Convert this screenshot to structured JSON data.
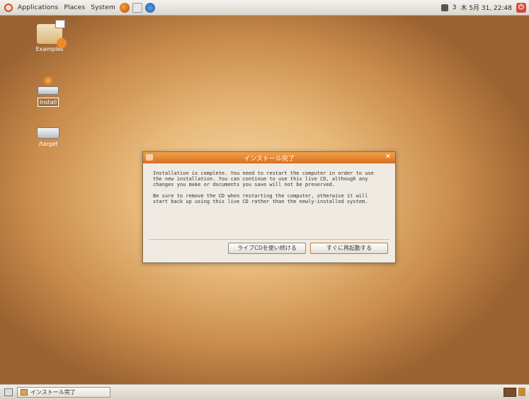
{
  "top_panel": {
    "menus": [
      "Applications",
      "Places",
      "System"
    ],
    "clock": "木 5月 31, 22:48",
    "user": "3"
  },
  "desktop": {
    "icons": [
      {
        "label": "Examples"
      },
      {
        "label": "Install"
      },
      {
        "label": "/target"
      }
    ]
  },
  "dialog": {
    "title": "インストール完了",
    "paragraph1": "Installation is complete. You need to restart the computer in order to use the new installation. You can continue to use this live CD, although any changes you make or documents you save will not be preserved.",
    "paragraph2": "Be sure to remove the CD when restarting the computer, otherwise it will start back up using this live CD rather than the newly-installed system.",
    "buttons": {
      "continue": "ライブCDを使い続ける",
      "restart": "すぐに再起動する"
    }
  },
  "bottom_panel": {
    "taskbar_item": "インストール完了"
  },
  "colors": {
    "accent": "#d96f1e",
    "panel": "#e6e1d7"
  }
}
